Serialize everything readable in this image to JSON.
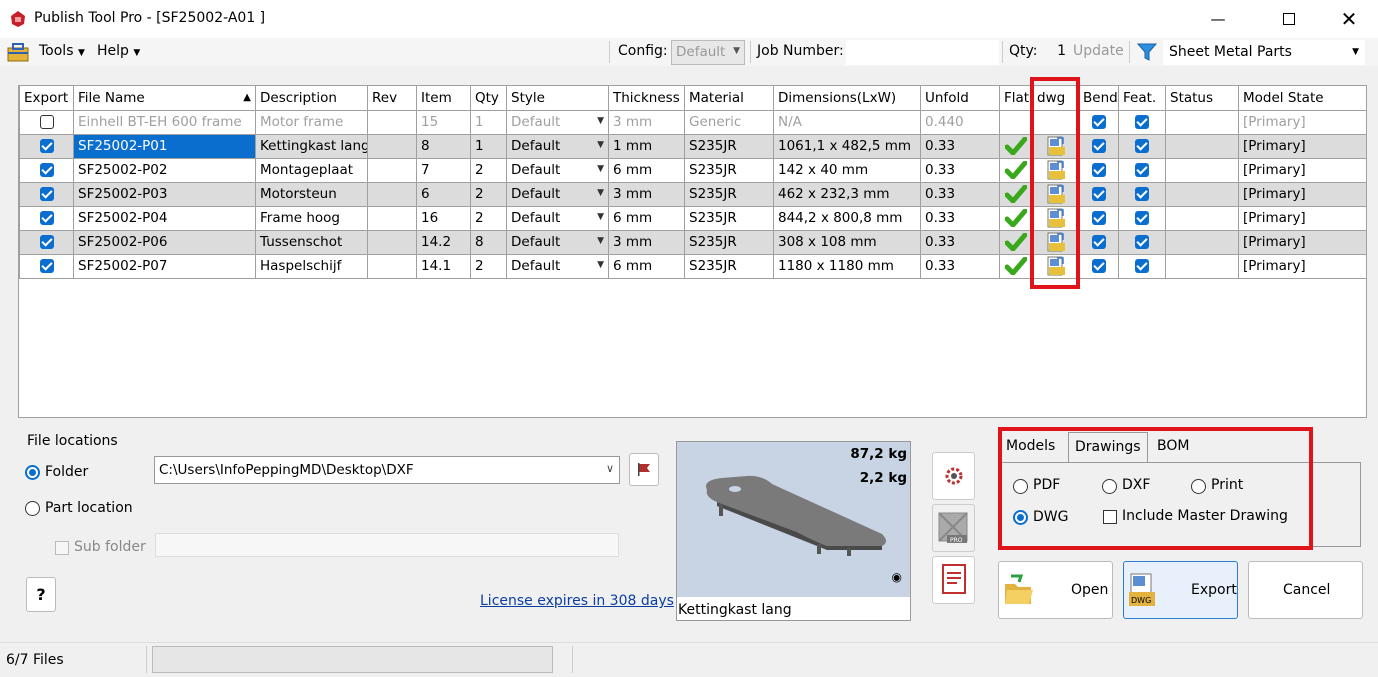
{
  "window": {
    "title": "Publish Tool Pro - [SF25002-A01 ]"
  },
  "toolbar": {
    "tools_label": "Tools",
    "help_label": "Help",
    "config_label": "Config:",
    "config_value": "Default",
    "job_label": "Job Number:",
    "job_value": "",
    "qty_label": "Qty:",
    "qty_value": "1",
    "update_label": "Update",
    "category_value": "Sheet Metal Parts"
  },
  "grid": {
    "headers": [
      "Export",
      "File Name",
      "Description",
      "Rev",
      "Item",
      "Qty",
      "Style",
      "Thickness",
      "Material",
      "Dimensions(LxW)",
      "Unfold",
      "Flat",
      "dwg",
      "Bend",
      "Feat.",
      "Status",
      "Model State"
    ],
    "rows": [
      {
        "export": false,
        "file": "Einhell BT-EH 600 frame",
        "desc": "Motor frame",
        "rev": "",
        "item": "15",
        "qty": "1",
        "style": "Default",
        "thk": "3 mm",
        "mat": "Generic",
        "dim": "N/A",
        "unfold": "0.440",
        "flat": false,
        "dwg": false,
        "bend": true,
        "feat": true,
        "status": "",
        "state": "[Primary]"
      },
      {
        "export": true,
        "file": "SF25002-P01",
        "desc": "Kettingkast lang",
        "rev": "",
        "item": "8",
        "qty": "1",
        "style": "Default",
        "thk": "1 mm",
        "mat": "S235JR",
        "dim": "1061,1 x 482,5 mm",
        "unfold": "0.33",
        "flat": true,
        "dwg": true,
        "bend": true,
        "feat": true,
        "status": "",
        "state": "[Primary]"
      },
      {
        "export": true,
        "file": "SF25002-P02",
        "desc": "Montageplaat",
        "rev": "",
        "item": "7",
        "qty": "2",
        "style": "Default",
        "thk": "6 mm",
        "mat": "S235JR",
        "dim": "142 x 40 mm",
        "unfold": "0.33",
        "flat": true,
        "dwg": true,
        "bend": true,
        "feat": true,
        "status": "",
        "state": "[Primary]"
      },
      {
        "export": true,
        "file": "SF25002-P03",
        "desc": "Motorsteun",
        "rev": "",
        "item": "6",
        "qty": "2",
        "style": "Default",
        "thk": "3 mm",
        "mat": "S235JR",
        "dim": "462 x 232,3 mm",
        "unfold": "0.33",
        "flat": true,
        "dwg": true,
        "bend": true,
        "feat": true,
        "status": "",
        "state": "[Primary]"
      },
      {
        "export": true,
        "file": "SF25002-P04",
        "desc": "Frame hoog",
        "rev": "",
        "item": "16",
        "qty": "2",
        "style": "Default",
        "thk": "6 mm",
        "mat": "S235JR",
        "dim": "844,2 x 800,8 mm",
        "unfold": "0.33",
        "flat": true,
        "dwg": true,
        "bend": true,
        "feat": true,
        "status": "",
        "state": "[Primary]"
      },
      {
        "export": true,
        "file": "SF25002-P06",
        "desc": "Tussenschot",
        "rev": "",
        "item": "14.2",
        "qty": "8",
        "style": "Default",
        "thk": "3 mm",
        "mat": "S235JR",
        "dim": "308 x 108 mm",
        "unfold": "0.33",
        "flat": true,
        "dwg": true,
        "bend": true,
        "feat": true,
        "status": "",
        "state": "[Primary]"
      },
      {
        "export": true,
        "file": "SF25002-P07",
        "desc": "Haspelschijf",
        "rev": "",
        "item": "14.1",
        "qty": "2",
        "style": "Default",
        "thk": "6 mm",
        "mat": "S235JR",
        "dim": "1180 x 1180 mm",
        "unfold": "0.33",
        "flat": true,
        "dwg": true,
        "bend": true,
        "feat": true,
        "status": "",
        "state": "[Primary]"
      }
    ]
  },
  "file_locations": {
    "label": "File locations",
    "folder_label": "Folder",
    "folder_path": "C:\\Users\\InfoPeppingMD\\Desktop\\DXF",
    "part_location_label": "Part location",
    "subfolder_label": "Sub folder"
  },
  "license": "License expires in 308 days",
  "preview": {
    "weight1": "87,2 kg",
    "weight2": "2,2 kg",
    "caption": "Kettingkast lang"
  },
  "tabs": {
    "models": "Models",
    "drawings": "Drawings",
    "bom": "BOM"
  },
  "options": {
    "pdf": "PDF",
    "dxf": "DXF",
    "print": "Print",
    "dwg": "DWG",
    "include_master": "Include Master Drawing"
  },
  "buttons": {
    "open": "Open",
    "export": "Export",
    "cancel": "Cancel",
    "help": "?"
  },
  "status": {
    "files": "6/7 Files"
  },
  "colors": {
    "accent": "#0a6ecf",
    "highlight": "#e0121a",
    "check": "#3aa81c"
  }
}
